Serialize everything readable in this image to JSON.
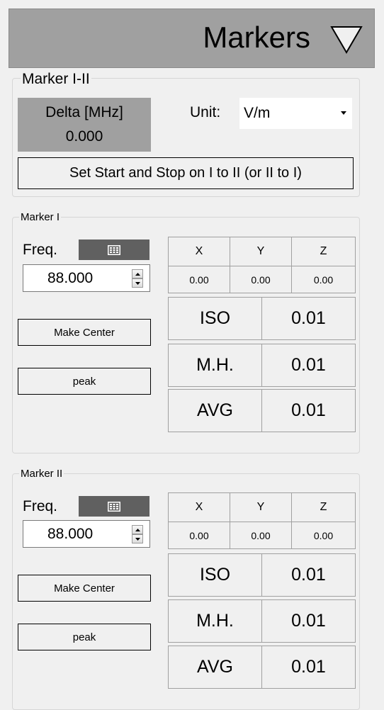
{
  "header": {
    "title": "Markers",
    "toggle_icon": "triangle-down-icon"
  },
  "marker_delta": {
    "legend": "Marker I-II",
    "delta_label": "Delta [MHz]",
    "delta_value": "0.000",
    "unit_label": "Unit:",
    "unit_value": "V/m",
    "set_button": "Set Start and Stop on I to II (or II to I)"
  },
  "markers": [
    {
      "legend": "Marker I",
      "freq_label": "Freq.",
      "freq_value": "88.000",
      "make_center": "Make Center",
      "peak": "peak",
      "xyz_headers": [
        "X",
        "Y",
        "Z"
      ],
      "xyz_values": [
        "0.00",
        "0.00",
        "0.00"
      ],
      "metrics": [
        {
          "label": "ISO",
          "value": "0.01"
        },
        {
          "label": "M.H.",
          "value": "0.01"
        },
        {
          "label": "AVG",
          "value": "0.01"
        }
      ]
    },
    {
      "legend": "Marker II",
      "freq_label": "Freq.",
      "freq_value": "88.000",
      "make_center": "Make Center",
      "peak": "peak",
      "xyz_headers": [
        "X",
        "Y",
        "Z"
      ],
      "xyz_values": [
        "0.00",
        "0.00",
        "0.00"
      ],
      "metrics": [
        {
          "label": "ISO",
          "value": "0.01"
        },
        {
          "label": "M.H.",
          "value": "0.01"
        },
        {
          "label": "AVG",
          "value": "0.01"
        }
      ]
    }
  ]
}
